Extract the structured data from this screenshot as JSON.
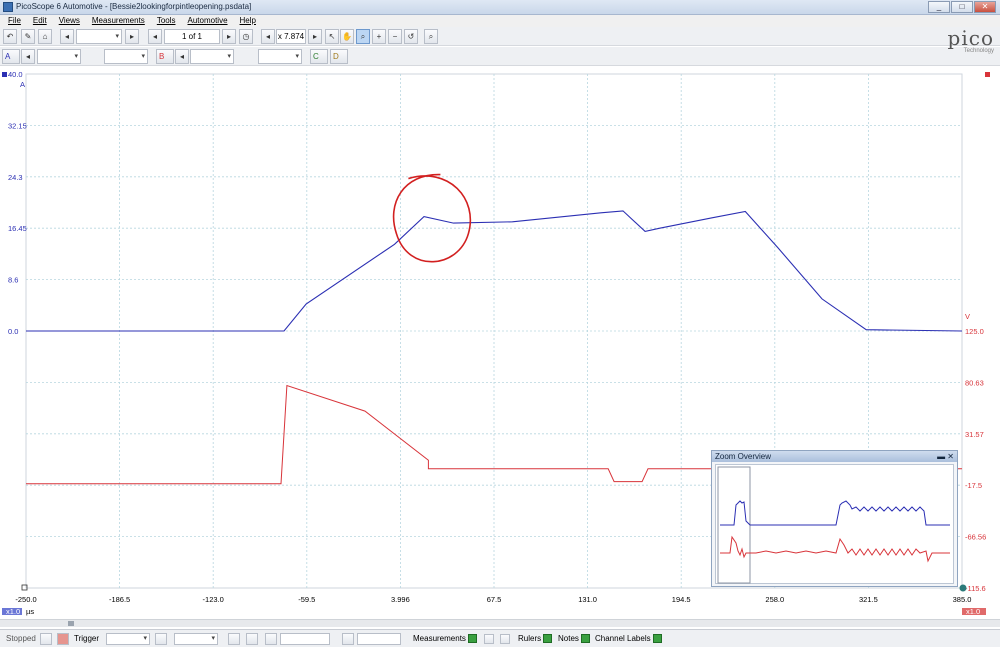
{
  "window": {
    "title": "PicoScope 6 Automotive - [Bessie2lookingforpintleopening.psdata]",
    "buttons": [
      "_",
      "□",
      "✕"
    ]
  },
  "menu": [
    "File",
    "Edit",
    "Views",
    "Measurements",
    "Tools",
    "Automotive",
    "Help"
  ],
  "toolbar1": {
    "page": "1 of 1",
    "zoom": "x 7.874"
  },
  "toolbar2": {
    "channel_a": "A",
    "channel_b": "B",
    "channel_c": "C",
    "channel_d": "D"
  },
  "logo": {
    "text": "pico",
    "sub": "Technology"
  },
  "colors": {
    "channel_a": "#2b2fb3",
    "channel_b": "#d8343a",
    "grid": "#b7d6df",
    "annotation": "#d22020"
  },
  "chart_data": {
    "type": "line",
    "x_unit": "µs",
    "x_ticks": [
      "-250.0",
      "-186.5",
      "-123.0",
      "-59.5",
      "3.996",
      "67.5",
      "131.0",
      "194.5",
      "258.0",
      "321.5",
      "385.0"
    ],
    "x_range": [
      -250.0,
      385.0
    ],
    "left_axis": {
      "unit": "A",
      "ticks": [
        "40.0",
        "32.15",
        "24.3",
        "16.45",
        "8.6",
        "0.0"
      ]
    },
    "right_axis": {
      "unit": "V",
      "ticks": [
        "125.0",
        "80.63",
        "31.57",
        "-17.5",
        "-66.56",
        "-115.6"
      ]
    },
    "series": [
      {
        "name": "A",
        "color": "#2b2fb3",
        "points": [
          [
            -250,
            0.0
          ],
          [
            -75,
            0.0
          ],
          [
            -60,
            4.2
          ],
          [
            0,
            13.5
          ],
          [
            20,
            17.8
          ],
          [
            40,
            16.8
          ],
          [
            80,
            17.0
          ],
          [
            140,
            18.4
          ],
          [
            155,
            18.7
          ],
          [
            170,
            15.5
          ],
          [
            180,
            16.0
          ],
          [
            215,
            17.6
          ],
          [
            238,
            18.6
          ],
          [
            260,
            13.0
          ],
          [
            290,
            5.0
          ],
          [
            320,
            0.2
          ],
          [
            385,
            0.0
          ]
        ]
      },
      {
        "name": "B",
        "color": "#d8343a",
        "points": [
          [
            -250,
            -18
          ],
          [
            -77,
            -18
          ],
          [
            -73,
            74
          ],
          [
            -20,
            50
          ],
          [
            23,
            4
          ],
          [
            23,
            -4
          ],
          [
            145,
            -4
          ],
          [
            149,
            -16
          ],
          [
            168,
            -16
          ],
          [
            172,
            -4
          ],
          [
            385,
            -4
          ]
        ]
      }
    ]
  },
  "zoom_overview": {
    "title": "Zoom Overview"
  },
  "bottom": {
    "scale_a": "x1.0",
    "scale_b": "x1.0",
    "x_unit": "µs"
  },
  "statusbar": {
    "state": "Stopped",
    "trigger": "Trigger",
    "measurements": "Measurements",
    "rulers": "Rulers",
    "notes": "Notes",
    "channel_labels": "Channel Labels"
  }
}
